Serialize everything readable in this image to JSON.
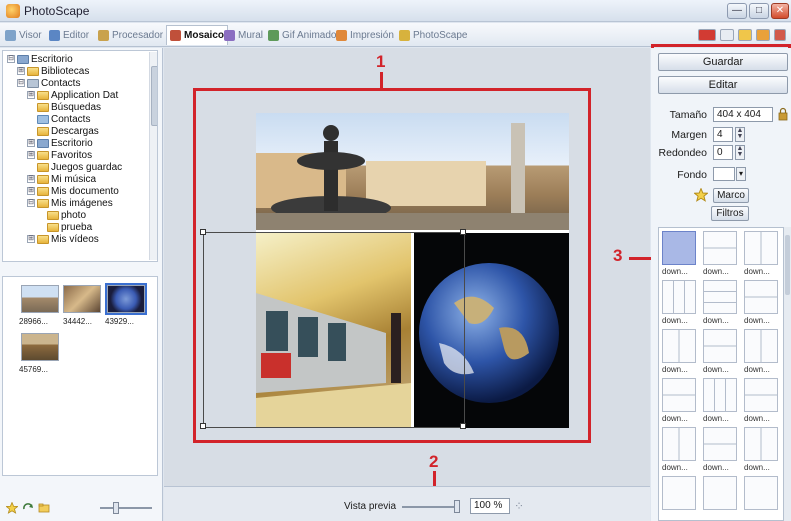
{
  "window": {
    "title": "PhotoScape",
    "min_label": "—",
    "max_label": "□",
    "close_label": "✕"
  },
  "tabs": [
    {
      "label": "Visor",
      "active": false
    },
    {
      "label": "Editor",
      "active": false
    },
    {
      "label": "Procesador",
      "active": false
    },
    {
      "label": "Mosaico",
      "active": true
    },
    {
      "label": "Mural",
      "active": false
    },
    {
      "label": "Gif Animado",
      "active": false
    },
    {
      "label": "Impresión",
      "active": false
    },
    {
      "label": "PhotoScape",
      "active": false
    }
  ],
  "tree": [
    {
      "label": "Escritorio",
      "level": 0,
      "expander": "⊟"
    },
    {
      "label": "Bibliotecas",
      "level": 1,
      "expander": "⊞"
    },
    {
      "label": "Contacts",
      "level": 1,
      "expander": "⊟"
    },
    {
      "label": "Application Dat",
      "level": 2,
      "expander": "⊞"
    },
    {
      "label": "Búsquedas",
      "level": 2,
      "expander": ""
    },
    {
      "label": "Contacts",
      "level": 2,
      "expander": ""
    },
    {
      "label": "Descargas",
      "level": 2,
      "expander": ""
    },
    {
      "label": "Escritorio",
      "level": 2,
      "expander": "⊞"
    },
    {
      "label": "Favoritos",
      "level": 2,
      "expander": "⊞"
    },
    {
      "label": "Juegos guardac",
      "level": 2,
      "expander": ""
    },
    {
      "label": "Mi música",
      "level": 2,
      "expander": "⊞"
    },
    {
      "label": "Mis documento",
      "level": 2,
      "expander": "⊞"
    },
    {
      "label": "Mis imágenes",
      "level": 2,
      "expander": "⊟"
    },
    {
      "label": "photo",
      "level": 3,
      "expander": ""
    },
    {
      "label": "prueba",
      "level": 3,
      "expander": ""
    },
    {
      "label": "Mis vídeos",
      "level": 2,
      "expander": "⊞"
    }
  ],
  "thumbnails": [
    {
      "caption": "28966...",
      "selected": false
    },
    {
      "caption": "34442...",
      "selected": false
    },
    {
      "caption": "43929...",
      "selected": true
    },
    {
      "caption": "45769...",
      "selected": false
    }
  ],
  "annotations": {
    "one": "1",
    "two": "2",
    "three": "3"
  },
  "bottom": {
    "preview_label": "Vista previa",
    "zoom_value": "100 %",
    "fit_glyph": "⁘"
  },
  "right": {
    "save_label": "Guardar",
    "edit_label": "Editar",
    "size_label": "Tamaño",
    "size_value": "404 x 404",
    "margin_label": "Margen",
    "margin_value": "4",
    "round_label": "Redondeo",
    "round_value": "0",
    "background_label": "Fondo",
    "frame_label": "Marco",
    "filters_label": "Filtros",
    "spin_up": "▲",
    "spin_down": "▼",
    "dropdown_arrow": "▾",
    "layout_caption": "down..."
  },
  "colors": {
    "annotation_red": "#d2232a",
    "selected_layout": "#a9b8e6"
  }
}
